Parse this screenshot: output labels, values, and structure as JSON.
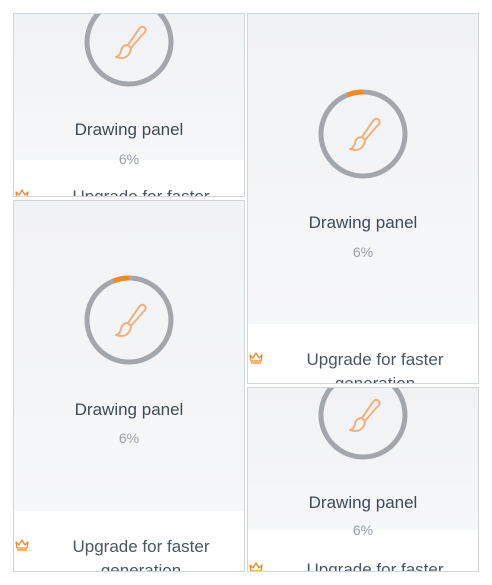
{
  "panels": [
    {
      "title": "Drawing panel",
      "percent": "6%",
      "upgrade_label": "Upgrade for faster generation"
    },
    {
      "title": "Drawing panel",
      "percent": "6%",
      "upgrade_label": "Upgrade for faster generation"
    },
    {
      "title": "Drawing panel",
      "percent": "6%",
      "upgrade_label": "Upgrade for faster generation"
    },
    {
      "title": "Drawing panel",
      "percent": "6%",
      "upgrade_label": "Upgrade for faster generation"
    }
  ],
  "progress_fraction": 0.06,
  "icons": {
    "center": "paintbrush-icon",
    "upgrade": "crown-icon"
  },
  "colors": {
    "accent": "#f08a24",
    "brush": "#f2b07c",
    "ring": "#a3a6aa",
    "card_bg": "#f3f4f6",
    "title": "#3f4a57",
    "muted": "#9aa1a9"
  }
}
